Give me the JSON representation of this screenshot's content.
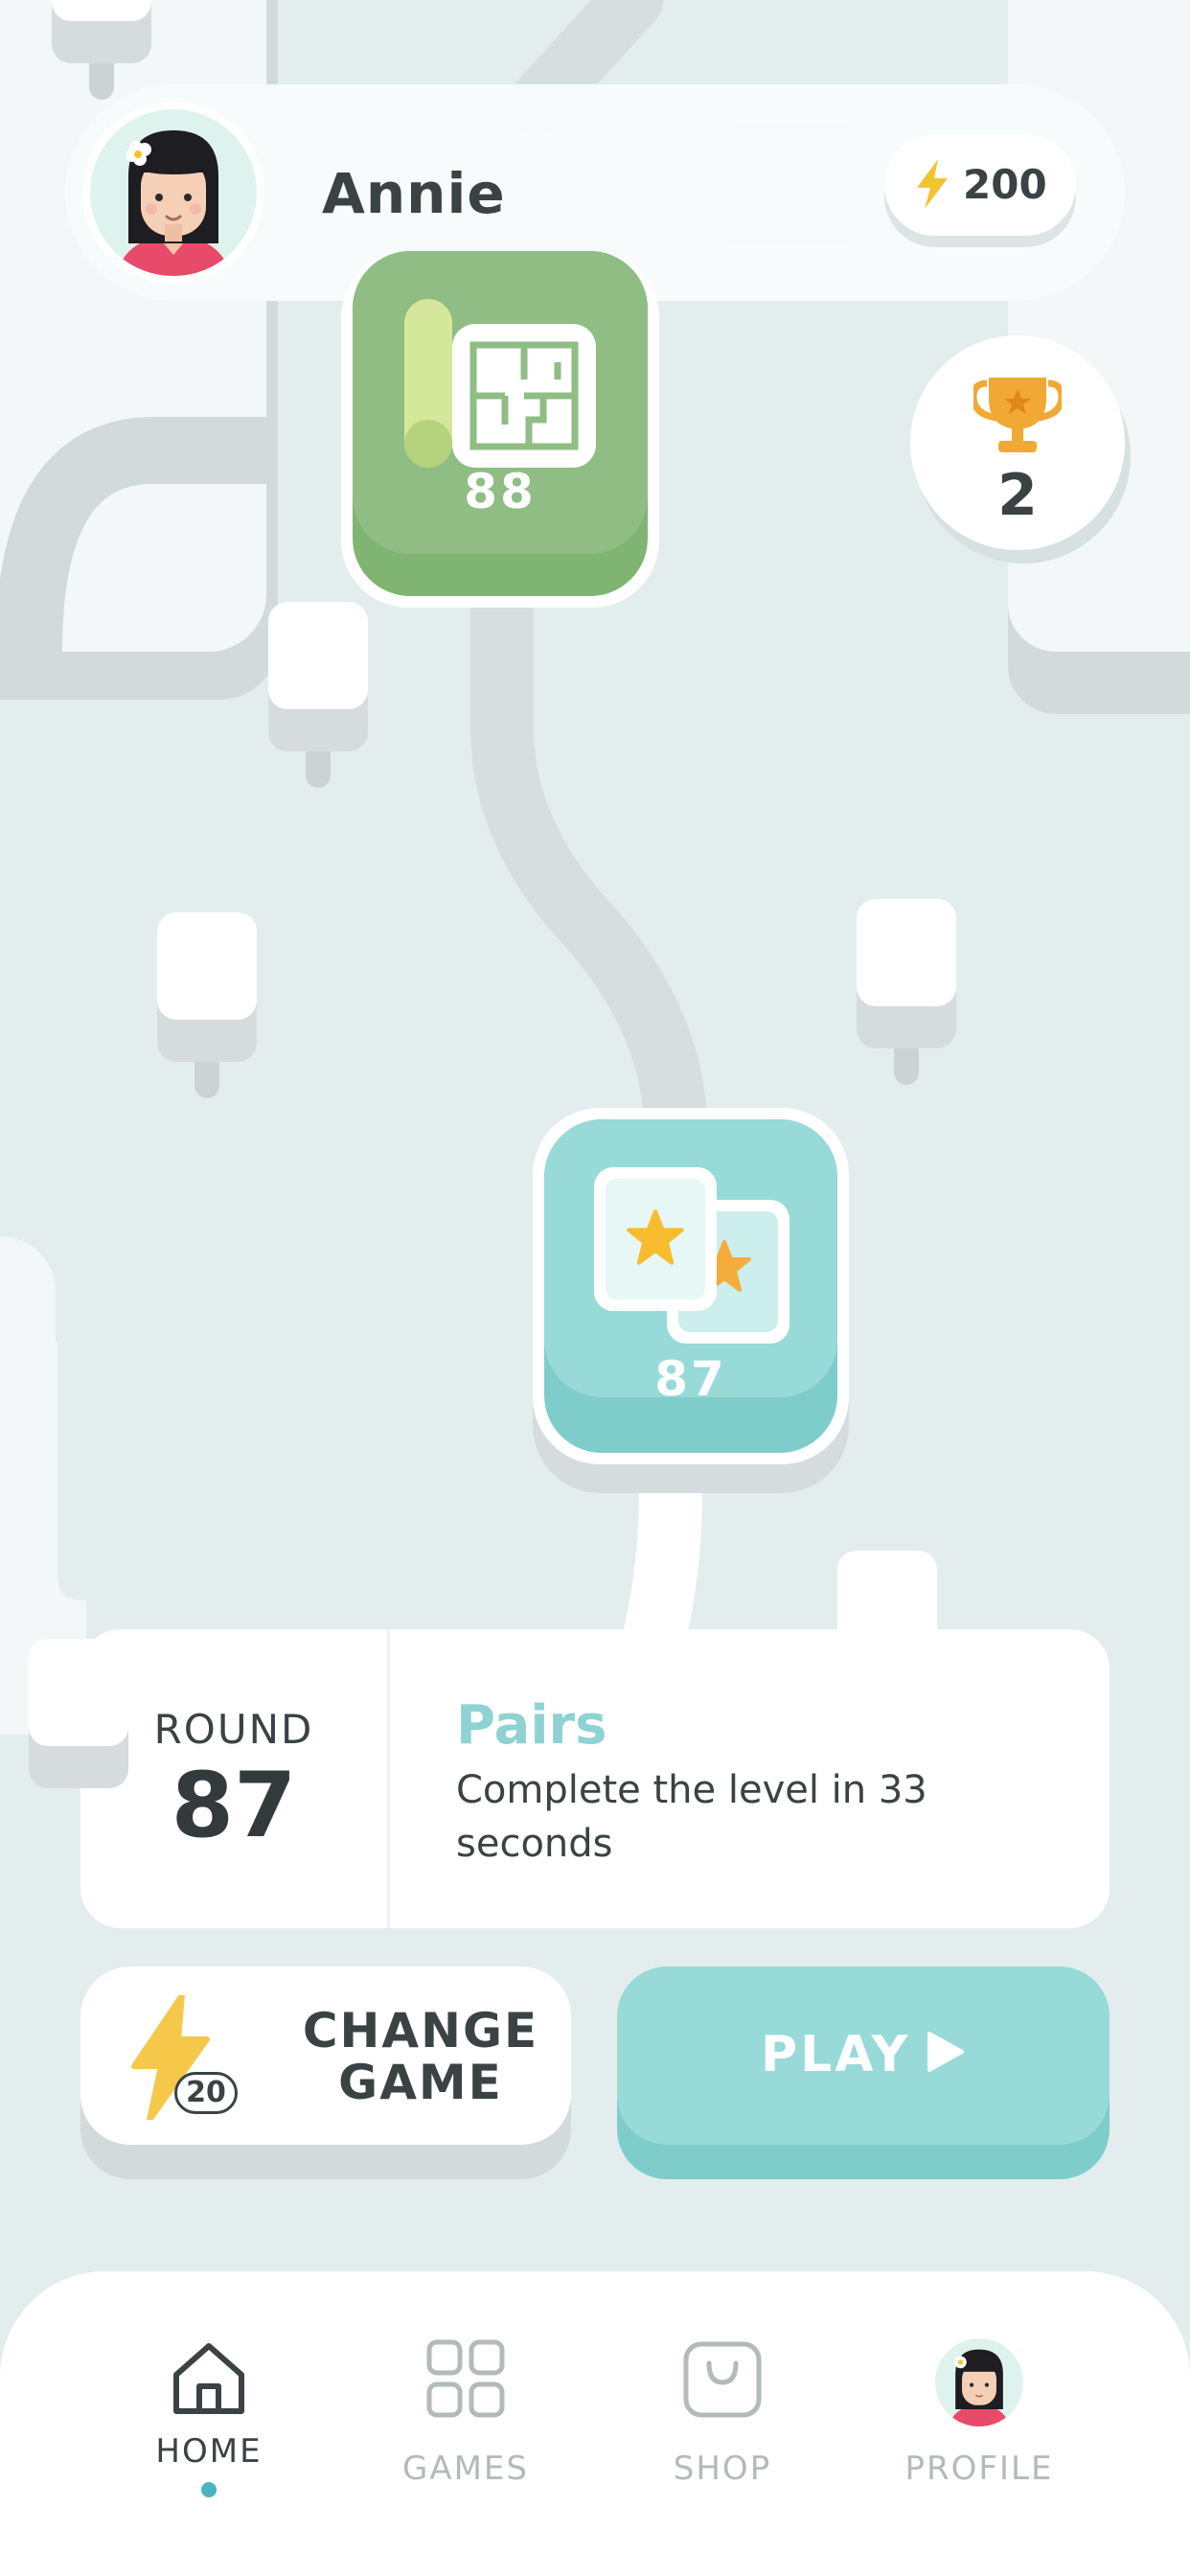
{
  "header": {
    "username": "Annie",
    "energy": "200"
  },
  "trophy": {
    "count": "2"
  },
  "levels": [
    {
      "number": "88",
      "game": "maze"
    },
    {
      "number": "87",
      "game": "pairs"
    }
  ],
  "round_card": {
    "label": "ROUND",
    "number": "87",
    "game_name": "Pairs",
    "description": "Complete the level in 33 seconds"
  },
  "actions": {
    "change_cost": "20",
    "change_label_line1": "CHANGE",
    "change_label_line2": "GAME",
    "play_label": "PLAY"
  },
  "nav": {
    "items": [
      {
        "label": "HOME",
        "icon": "home-icon",
        "active": true
      },
      {
        "label": "GAMES",
        "icon": "grid-icon",
        "active": false
      },
      {
        "label": "SHOP",
        "icon": "bag-icon",
        "active": false
      },
      {
        "label": "PROFILE",
        "icon": "avatar",
        "active": false
      }
    ]
  },
  "colors": {
    "accent_teal": "#97dad8",
    "maze_green": "#8fbd84",
    "energy_yellow": "#f3c331",
    "trophy_orange": "#f2a834",
    "active_dot": "#4bb3c0"
  }
}
